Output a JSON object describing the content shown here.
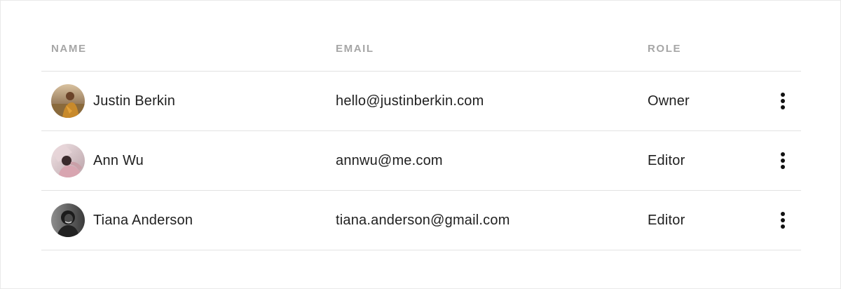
{
  "table": {
    "headers": {
      "name": "NAME",
      "email": "EMAIL",
      "role": "ROLE"
    },
    "rows": [
      {
        "name": "Justin Berkin",
        "email": "hello@justinberkin.com",
        "role": "Owner",
        "avatar_icon": "user-avatar-photo",
        "actions_icon": "more-vertical-icon"
      },
      {
        "name": "Ann Wu",
        "email": "annwu@me.com",
        "role": "Editor",
        "avatar_icon": "user-avatar-photo",
        "actions_icon": "more-vertical-icon"
      },
      {
        "name": "Tiana Anderson",
        "email": "tiana.anderson@gmail.com",
        "role": "Editor",
        "avatar_icon": "user-avatar-photo",
        "actions_icon": "more-vertical-icon"
      }
    ]
  }
}
